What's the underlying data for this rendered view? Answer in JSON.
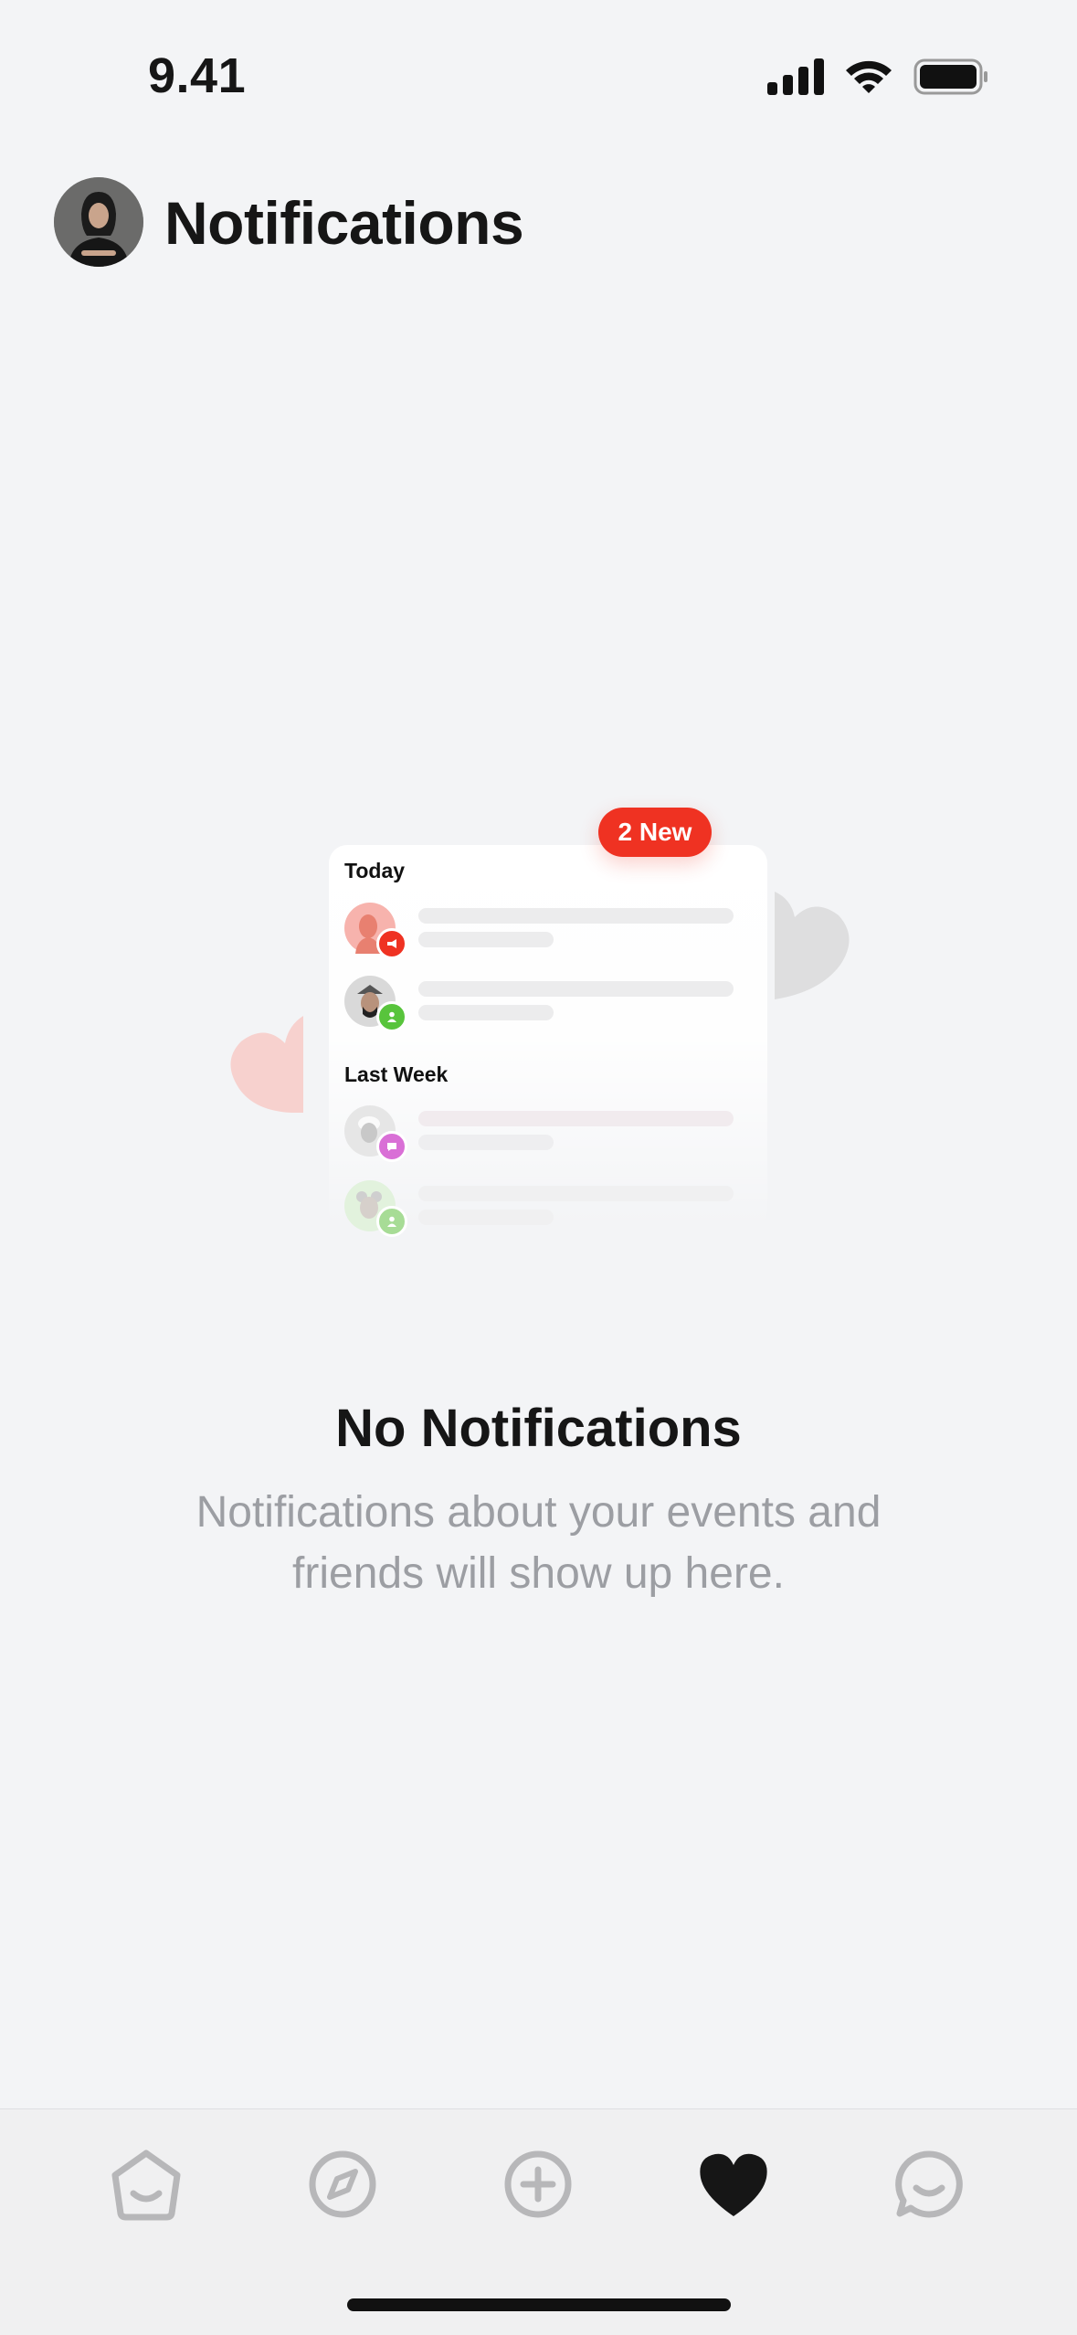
{
  "status_bar": {
    "time": "9.41",
    "icons": [
      "cellular-signal-icon",
      "wifi-icon",
      "battery-icon"
    ]
  },
  "header": {
    "title": "Notifications",
    "avatar": "profile-avatar"
  },
  "illustration": {
    "new_badge": "2 New",
    "sections": [
      {
        "label": "Today",
        "rows": [
          {
            "avatar_color": "#f7b3ad",
            "badge_color": "#ef3222",
            "badge_icon": "megaphone-icon"
          },
          {
            "avatar_color": "#d9d9d9",
            "badge_color": "#58c43c",
            "badge_icon": "person-icon"
          }
        ]
      },
      {
        "label": "Last Week",
        "rows": [
          {
            "avatar_color": "#e6e6e6",
            "badge_color": "#d96fd6",
            "badge_icon": "chat-bubble-icon"
          },
          {
            "avatar_color": "#e2f2dd",
            "badge_color": "#a7dc96",
            "badge_icon": "person-icon"
          }
        ]
      }
    ],
    "hearts": [
      {
        "color": "#f7d1ce",
        "icon": "heart-icon"
      },
      {
        "color": "#dededf",
        "icon": "heart-icon"
      }
    ]
  },
  "empty_state": {
    "title": "No Notifications",
    "subtitle_line1": "Notifications about your events and",
    "subtitle_line2": "friends will show up here."
  },
  "tab_bar": {
    "tabs": [
      {
        "icon": "home-icon",
        "active": false
      },
      {
        "icon": "compass-icon",
        "active": false
      },
      {
        "icon": "plus-circle-icon",
        "active": false
      },
      {
        "icon": "heart-icon",
        "active": true
      },
      {
        "icon": "chat-icon",
        "active": false
      }
    ]
  },
  "colors": {
    "background": "#f3f4f6",
    "accent_red": "#ef3222",
    "tab_inactive": "#b7b7b9",
    "tab_active": "#161616"
  }
}
